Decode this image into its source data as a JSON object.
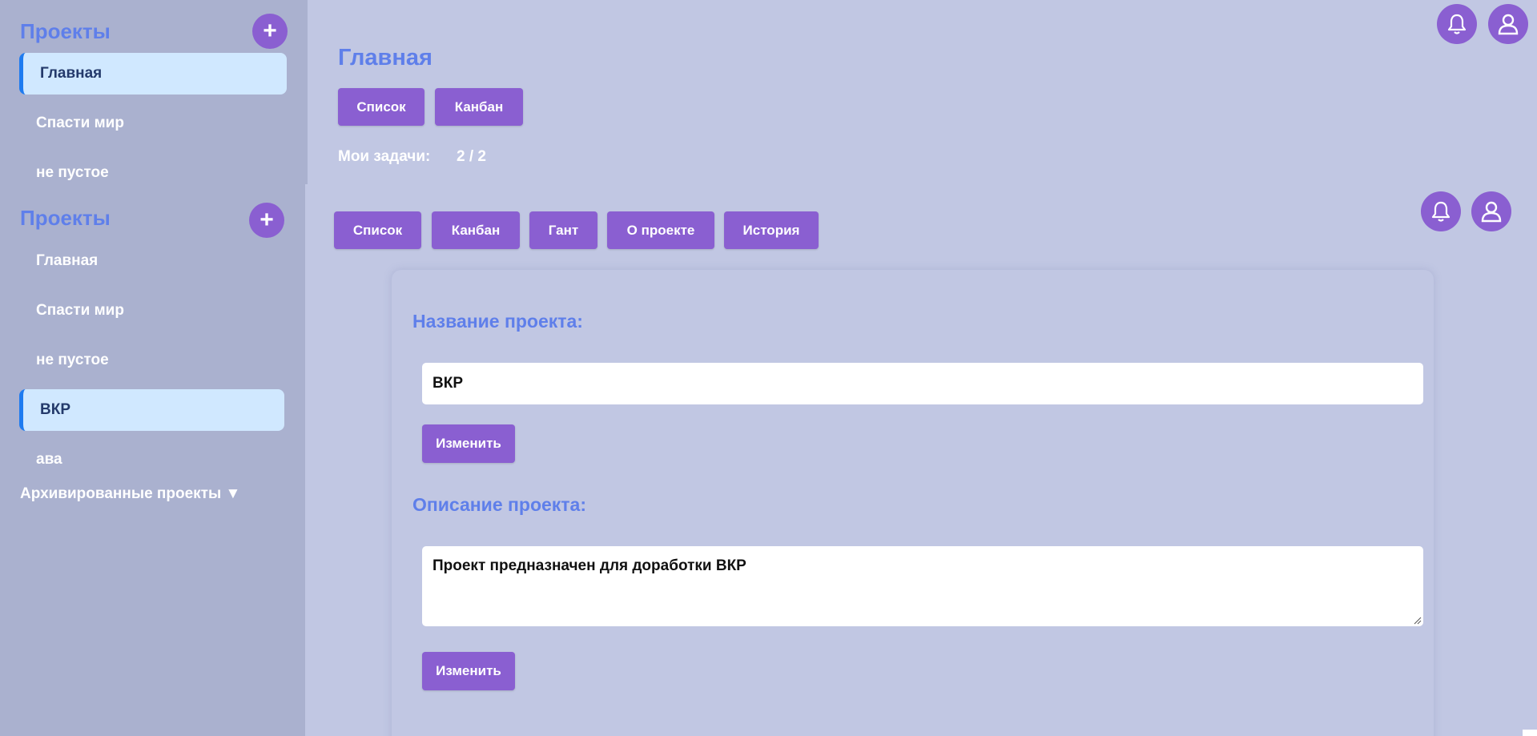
{
  "sidebar_top": {
    "title": "Проекты",
    "add_label": "+",
    "items": [
      {
        "label": "Главная",
        "active": true
      },
      {
        "label": "Спасти мир",
        "active": false
      },
      {
        "label": "не пустое",
        "active": false
      }
    ]
  },
  "sidebar_bottom": {
    "title": "Проекты",
    "add_label": "+",
    "items": [
      {
        "label": "Главная",
        "active": false
      },
      {
        "label": "Спасти мир",
        "active": false
      },
      {
        "label": "не пустое",
        "active": false
      },
      {
        "label": "ВКР",
        "active": true
      },
      {
        "label": "ава",
        "active": false
      }
    ],
    "archived_label": "Архивированные проекты ▼"
  },
  "home": {
    "title": "Главная",
    "tabs": [
      "Список",
      "Канбан"
    ],
    "my_tasks_label": "Мои задачи:",
    "my_tasks_count": "2 / 2"
  },
  "project": {
    "tabs": [
      "Список",
      "Канбан",
      "Гант",
      "О проекте",
      "История"
    ],
    "name_label": "Название проекта:",
    "name_value": "ВКР",
    "change_label": "Изменить",
    "description_label": "Описание проекта:",
    "description_value": "Проект предназначен для доработки ВКР"
  },
  "icons": {
    "notification": "bell-icon",
    "profile": "user-icon"
  },
  "colors": {
    "background": "#c1c7e3",
    "sidebar": "#aab1cf",
    "accent": "#8a5fd1",
    "title_blue": "#5f7fea",
    "active_item_bg": "#d0e8ff",
    "active_item_border": "#1e7bf0"
  }
}
